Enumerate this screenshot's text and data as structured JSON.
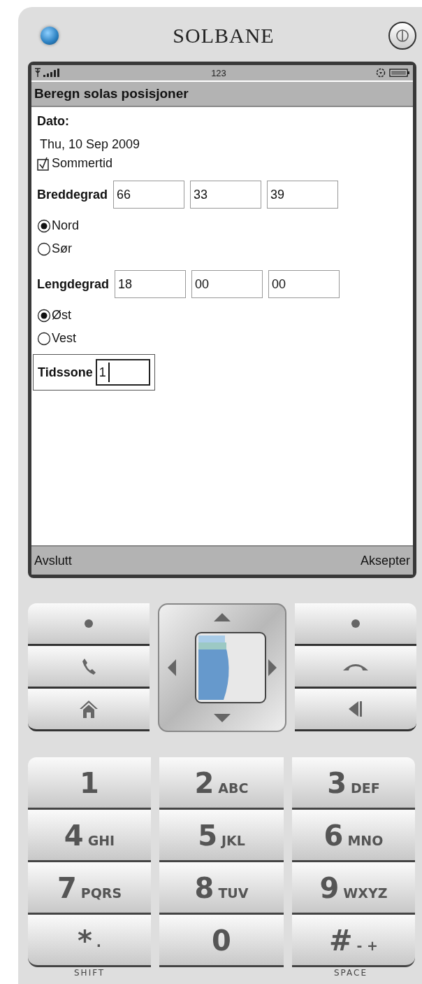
{
  "app_title": "SOLBANE",
  "status_bar": {
    "input_mode": "123"
  },
  "screen_title": "Beregn solas posisjoner",
  "form": {
    "date_label": "Dato:",
    "date": "Thu, 10 Sep 2009",
    "checkbox": {
      "label": "Sommertid",
      "checked": true
    },
    "coordinates": [
      {
        "label": "Breddegrad",
        "values": [
          "66",
          "33",
          "39"
        ],
        "options": [
          {
            "label": "Nord",
            "selected": true
          },
          {
            "label": "Sør",
            "selected": false
          }
        ]
      },
      {
        "label": "Lengdegrad",
        "values": [
          "18",
          "00",
          "00"
        ],
        "options": [
          {
            "label": "Øst",
            "selected": true
          },
          {
            "label": "Vest",
            "selected": false
          }
        ]
      }
    ],
    "timezone": {
      "label": "Tidssone",
      "value": "1",
      "focused": true
    }
  },
  "softkeys": {
    "left": "Avslutt",
    "right": "Aksepter"
  },
  "keypad": [
    {
      "digit": "1"
    },
    {
      "digit": "2",
      "letters": "ABC"
    },
    {
      "digit": "3",
      "letters": "DEF"
    },
    {
      "digit": "4",
      "letters": "GHI"
    },
    {
      "digit": "5",
      "letters": "JKL"
    },
    {
      "digit": "6",
      "letters": "MNO"
    },
    {
      "digit": "7",
      "letters": "PQRS"
    },
    {
      "digit": "8",
      "letters": "TUV"
    },
    {
      "digit": "9",
      "letters": "WXYZ"
    },
    {
      "digit": "*",
      "letters": "·"
    },
    {
      "digit": "0"
    },
    {
      "digit": "#",
      "letters": "- +"
    }
  ],
  "key_captions": [
    "SHIFT",
    "SPACE"
  ]
}
